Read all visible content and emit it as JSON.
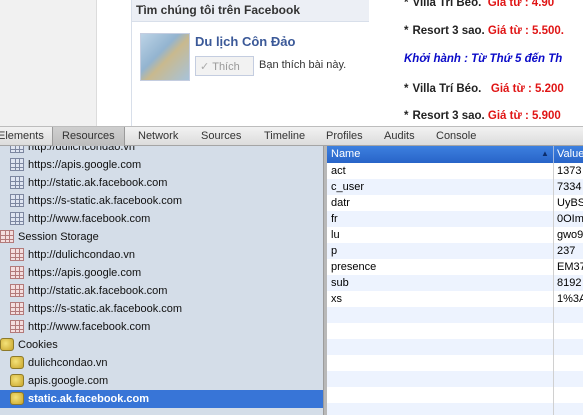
{
  "facebook_box": {
    "header": "Tìm chúng tôi trên Facebook",
    "page_name": "Du lịch Côn Đảo",
    "like_button": "Thích",
    "like_text": "Bạn thích bài này."
  },
  "promo": {
    "lines": [
      {
        "star": "*",
        "name": "Villa Trí Béo.",
        "price": "Giá từ : 4.90"
      },
      {
        "star": "*",
        "name": "Resort 3 sao.",
        "price": "Giá từ : 5.500."
      },
      {
        "text": "Khởi hành : Từ Thứ 5 đến Th"
      },
      {
        "star": "*",
        "name": "Villa Trí Béo.",
        "price": "Giá từ : 5.200"
      },
      {
        "star": "*",
        "name": "Resort 3 sao.",
        "price": "Giá từ : 5.900"
      }
    ]
  },
  "devtools": {
    "tabs": [
      "Elements",
      "Resources",
      "Network",
      "Sources",
      "Timeline",
      "Profiles",
      "Audits",
      "Console"
    ],
    "active_tab": "Resources",
    "tree": [
      {
        "label": "http://dulichcondao.vn",
        "icon": "local-storage-icon"
      },
      {
        "label": "https://apis.google.com",
        "icon": "local-storage-icon"
      },
      {
        "label": "http://static.ak.facebook.com",
        "icon": "local-storage-icon"
      },
      {
        "label": "https://s-static.ak.facebook.com",
        "icon": "local-storage-icon"
      },
      {
        "label": "http://www.facebook.com",
        "icon": "local-storage-icon"
      },
      {
        "label": "Session Storage",
        "icon": "session-storage-icon"
      },
      {
        "label": "http://dulichcondao.vn",
        "icon": "session-storage-icon"
      },
      {
        "label": "https://apis.google.com",
        "icon": "session-storage-icon"
      },
      {
        "label": "http://static.ak.facebook.com",
        "icon": "session-storage-icon"
      },
      {
        "label": "https://s-static.ak.facebook.com",
        "icon": "session-storage-icon"
      },
      {
        "label": "http://www.facebook.com",
        "icon": "session-storage-icon"
      },
      {
        "label": "Cookies",
        "icon": "cookie-icon"
      },
      {
        "label": "dulichcondao.vn",
        "icon": "cookie-icon"
      },
      {
        "label": "apis.google.com",
        "icon": "cookie-icon"
      },
      {
        "label": "static.ak.facebook.com",
        "icon": "cookie-icon",
        "selected": true
      }
    ],
    "grid": {
      "col_name": "Name",
      "col_value": "Value",
      "rows": [
        {
          "name": "act",
          "value": "1373"
        },
        {
          "name": "c_user",
          "value": "7334"
        },
        {
          "name": "datr",
          "value": "UyBS"
        },
        {
          "name": "fr",
          "value": "0OIm"
        },
        {
          "name": "lu",
          "value": "gwo9"
        },
        {
          "name": "p",
          "value": "237"
        },
        {
          "name": "presence",
          "value": "EM37"
        },
        {
          "name": "sub",
          "value": "8192"
        },
        {
          "name": "xs",
          "value": "1%3A"
        }
      ]
    }
  }
}
